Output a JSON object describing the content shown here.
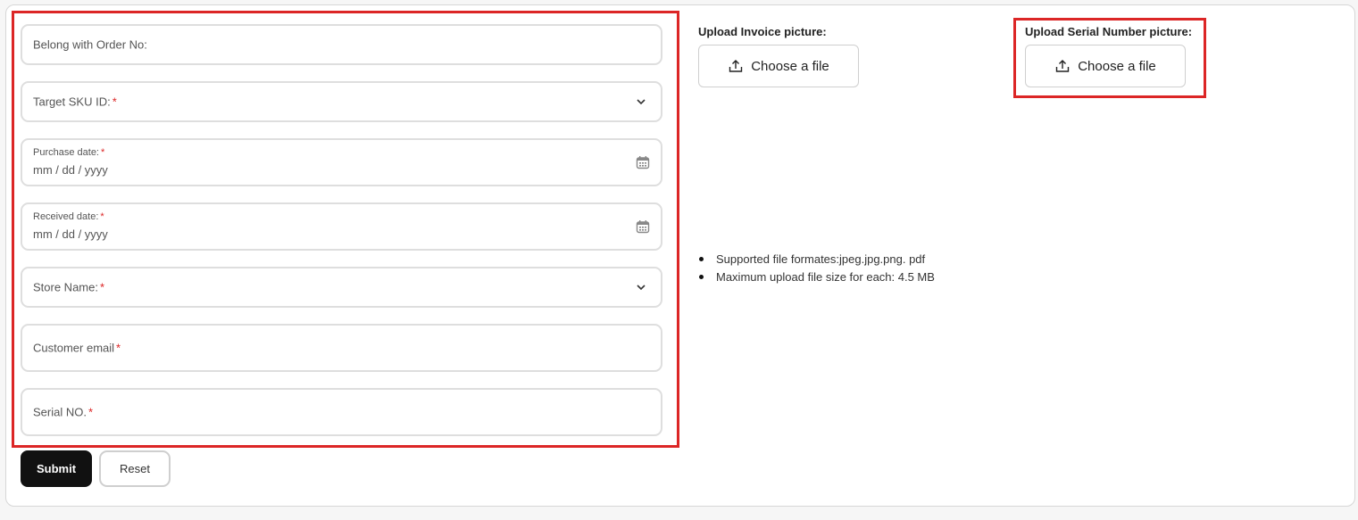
{
  "form": {
    "order_no": {
      "label": "Belong with Order No:"
    },
    "sku": {
      "label": "Target SKU ID:",
      "required": "*"
    },
    "purchase_date": {
      "label": "Purchase date:",
      "required": "*",
      "value": "mm / dd / yyyy"
    },
    "received_date": {
      "label": "Received date:",
      "required": "*",
      "value": "mm / dd / yyyy"
    },
    "store_name": {
      "label": "Store Name:",
      "required": "*"
    },
    "customer_email": {
      "label": "Customer email",
      "required": "*"
    },
    "serial_no": {
      "label": "Serial NO.",
      "required": "*"
    }
  },
  "actions": {
    "submit_label": "Submit",
    "reset_label": "Reset"
  },
  "upload_invoice": {
    "title": "Upload Invoice picture:",
    "button_label": "Choose a file"
  },
  "upload_serial": {
    "title": "Upload Serial Number picture:",
    "button_label": "Choose a file"
  },
  "notes": [
    "Supported file formates:jpeg.jpg.png. pdf",
    "Maximum upload file size for each: 4.5 MB"
  ],
  "colors": {
    "required": "#dc2626",
    "highlight": "#dc2626",
    "primary_button": "#111111"
  },
  "icons": {
    "dropdown": "chevron-down-icon",
    "date": "calendar-icon",
    "upload": "upload-icon"
  }
}
